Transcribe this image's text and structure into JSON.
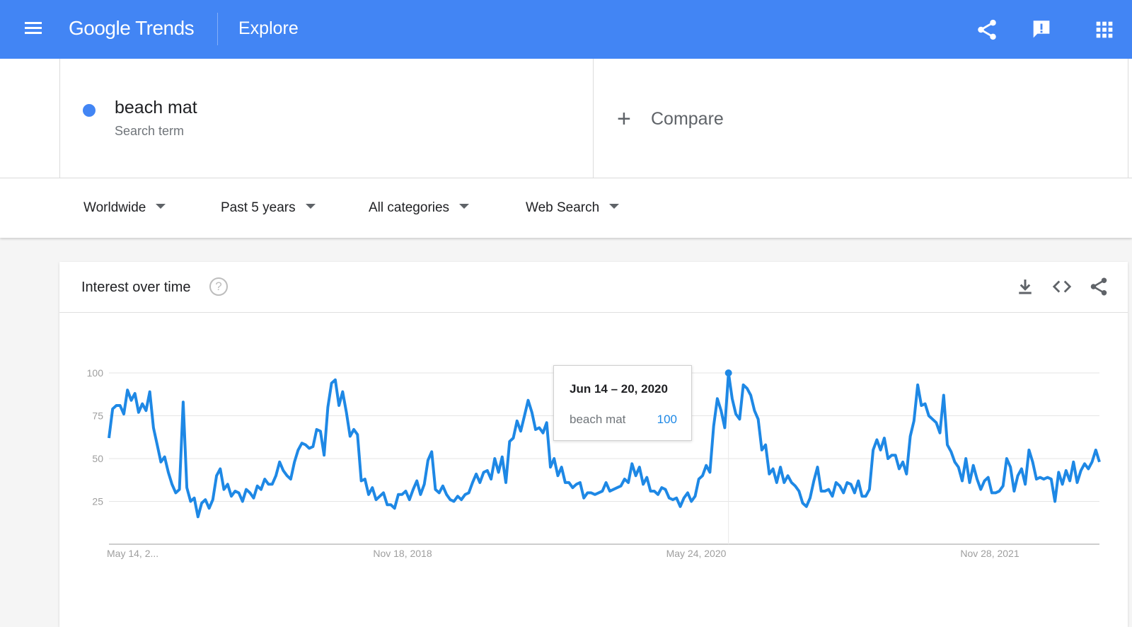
{
  "header": {
    "logo_google": "Google",
    "logo_trends": "Trends",
    "page": "Explore",
    "icons": [
      "menu-icon",
      "share-icon",
      "feedback-icon",
      "apps-icon"
    ]
  },
  "term": {
    "name": "beach mat",
    "type": "Search term",
    "color": "#4285f4"
  },
  "compare": {
    "label": "Compare"
  },
  "filters": {
    "region": "Worldwide",
    "time": "Past 5 years",
    "category": "All categories",
    "property": "Web Search"
  },
  "card": {
    "title": "Interest over time",
    "help": "?",
    "icons": [
      "download-icon",
      "embed-icon",
      "share-icon"
    ]
  },
  "tooltip": {
    "date": "Jun 14 – 20, 2020",
    "term": "beach mat",
    "value": "100"
  },
  "chart_data": {
    "type": "line",
    "series": [
      {
        "name": "beach mat",
        "color": "#1e88e5",
        "values": [
          62,
          79,
          81,
          81,
          76,
          90,
          84,
          88,
          77,
          82,
          78,
          89,
          68,
          58,
          48,
          51,
          42,
          35,
          30,
          32,
          83,
          33,
          25,
          27,
          16,
          24,
          26,
          21,
          26,
          40,
          44,
          32,
          35,
          28,
          31,
          30,
          25,
          32,
          30,
          27,
          34,
          32,
          38,
          35,
          35,
          40,
          48,
          43,
          40,
          38,
          48,
          55,
          59,
          58,
          56,
          57,
          67,
          66,
          52,
          80,
          94,
          96,
          81,
          89,
          77,
          63,
          67,
          64,
          37,
          38,
          29,
          33,
          26,
          28,
          30,
          23,
          23,
          21,
          29,
          29,
          31,
          26,
          32,
          37,
          29,
          35,
          49,
          54,
          32,
          30,
          34,
          29,
          26,
          25,
          28,
          26,
          29,
          30,
          36,
          41,
          36,
          42,
          43,
          38,
          50,
          42,
          51,
          36,
          60,
          62,
          72,
          66,
          75,
          84,
          77,
          67,
          68,
          65,
          71,
          45,
          50,
          40,
          45,
          36,
          36,
          33,
          35,
          36,
          27,
          30,
          30,
          29,
          30,
          31,
          36,
          31,
          32,
          33,
          34,
          38,
          36,
          47,
          40,
          45,
          35,
          39,
          31,
          31,
          29,
          33,
          32,
          27,
          26,
          27,
          22,
          27,
          30,
          25,
          28,
          38,
          40,
          46,
          42,
          69,
          85,
          78,
          68,
          100,
          85,
          76,
          73,
          93,
          91,
          87,
          78,
          73,
          55,
          58,
          41,
          44,
          36,
          45,
          36,
          40,
          36,
          34,
          31,
          24,
          22,
          27,
          37,
          45,
          31,
          31,
          32,
          28,
          36,
          34,
          30,
          36,
          35,
          30,
          37,
          28,
          28,
          32,
          55,
          61,
          55,
          62,
          50,
          52,
          52,
          44,
          48,
          41,
          63,
          72,
          93,
          81,
          82,
          75,
          73,
          71,
          65,
          87,
          58,
          54,
          48,
          45,
          37,
          50,
          36,
          46,
          38,
          32,
          37,
          39,
          30,
          30,
          31,
          34,
          50,
          45,
          31,
          40,
          44,
          35,
          55,
          48,
          38,
          39,
          38,
          39,
          38,
          25,
          42,
          35,
          43,
          37,
          48,
          36,
          43,
          47,
          44,
          48,
          55,
          48
        ]
      }
    ],
    "x_ticks": [
      "May 14, 2...",
      "Nov 18, 2018",
      "May 24, 2020",
      "Nov 28, 2021"
    ],
    "y_ticks": [
      25,
      50,
      75,
      100
    ],
    "ylim": [
      0,
      100
    ],
    "highlight": {
      "label": "Jun 14 – 20, 2020",
      "value": 100
    },
    "grid": true
  }
}
